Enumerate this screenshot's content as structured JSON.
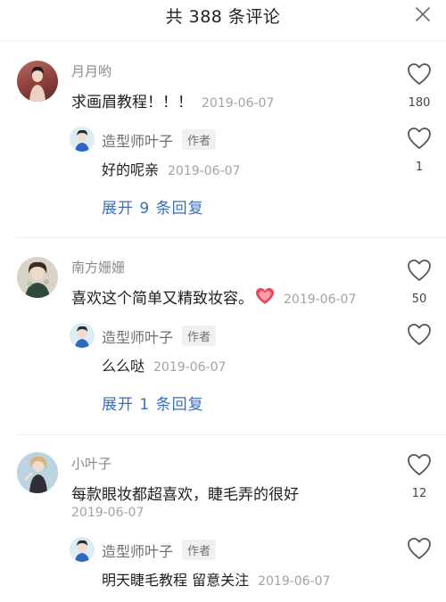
{
  "header": {
    "title": "共 388 条评论",
    "close_icon": "close-icon"
  },
  "colors": {
    "link": "#3a6fb8",
    "muted_text": "#a3a3a3",
    "username": "#8a8a8a",
    "heart_emoji": "#e8485a"
  },
  "threads": [
    {
      "username": "月月哟",
      "text": "求画眉教程！！！",
      "date": "2019-06-07",
      "likes": "180",
      "reply": {
        "username": "造型师叶子",
        "tag": "作者",
        "text": "好的呢亲",
        "date": "2019-06-07",
        "likes": "1"
      },
      "expand_label": "展开 9 条回复"
    },
    {
      "username": "南方姗姗",
      "text": "喜欢这个简单又精致妆容。",
      "emoji": "heart-emoji",
      "date": "2019-06-07",
      "likes": "50",
      "reply": {
        "username": "造型师叶子",
        "tag": "作者",
        "text": "么么哒",
        "date": "2019-06-07",
        "likes": ""
      },
      "expand_label": "展开 1 条回复"
    },
    {
      "username": "小叶子",
      "text": "每款眼妆都超喜欢，睫毛弄的很好",
      "date": "2019-06-07",
      "likes": "12",
      "reply": {
        "username": "造型师叶子",
        "tag": "作者",
        "text": "明天睫毛教程 留意关注",
        "date": "2019-06-07",
        "likes": ""
      }
    }
  ]
}
